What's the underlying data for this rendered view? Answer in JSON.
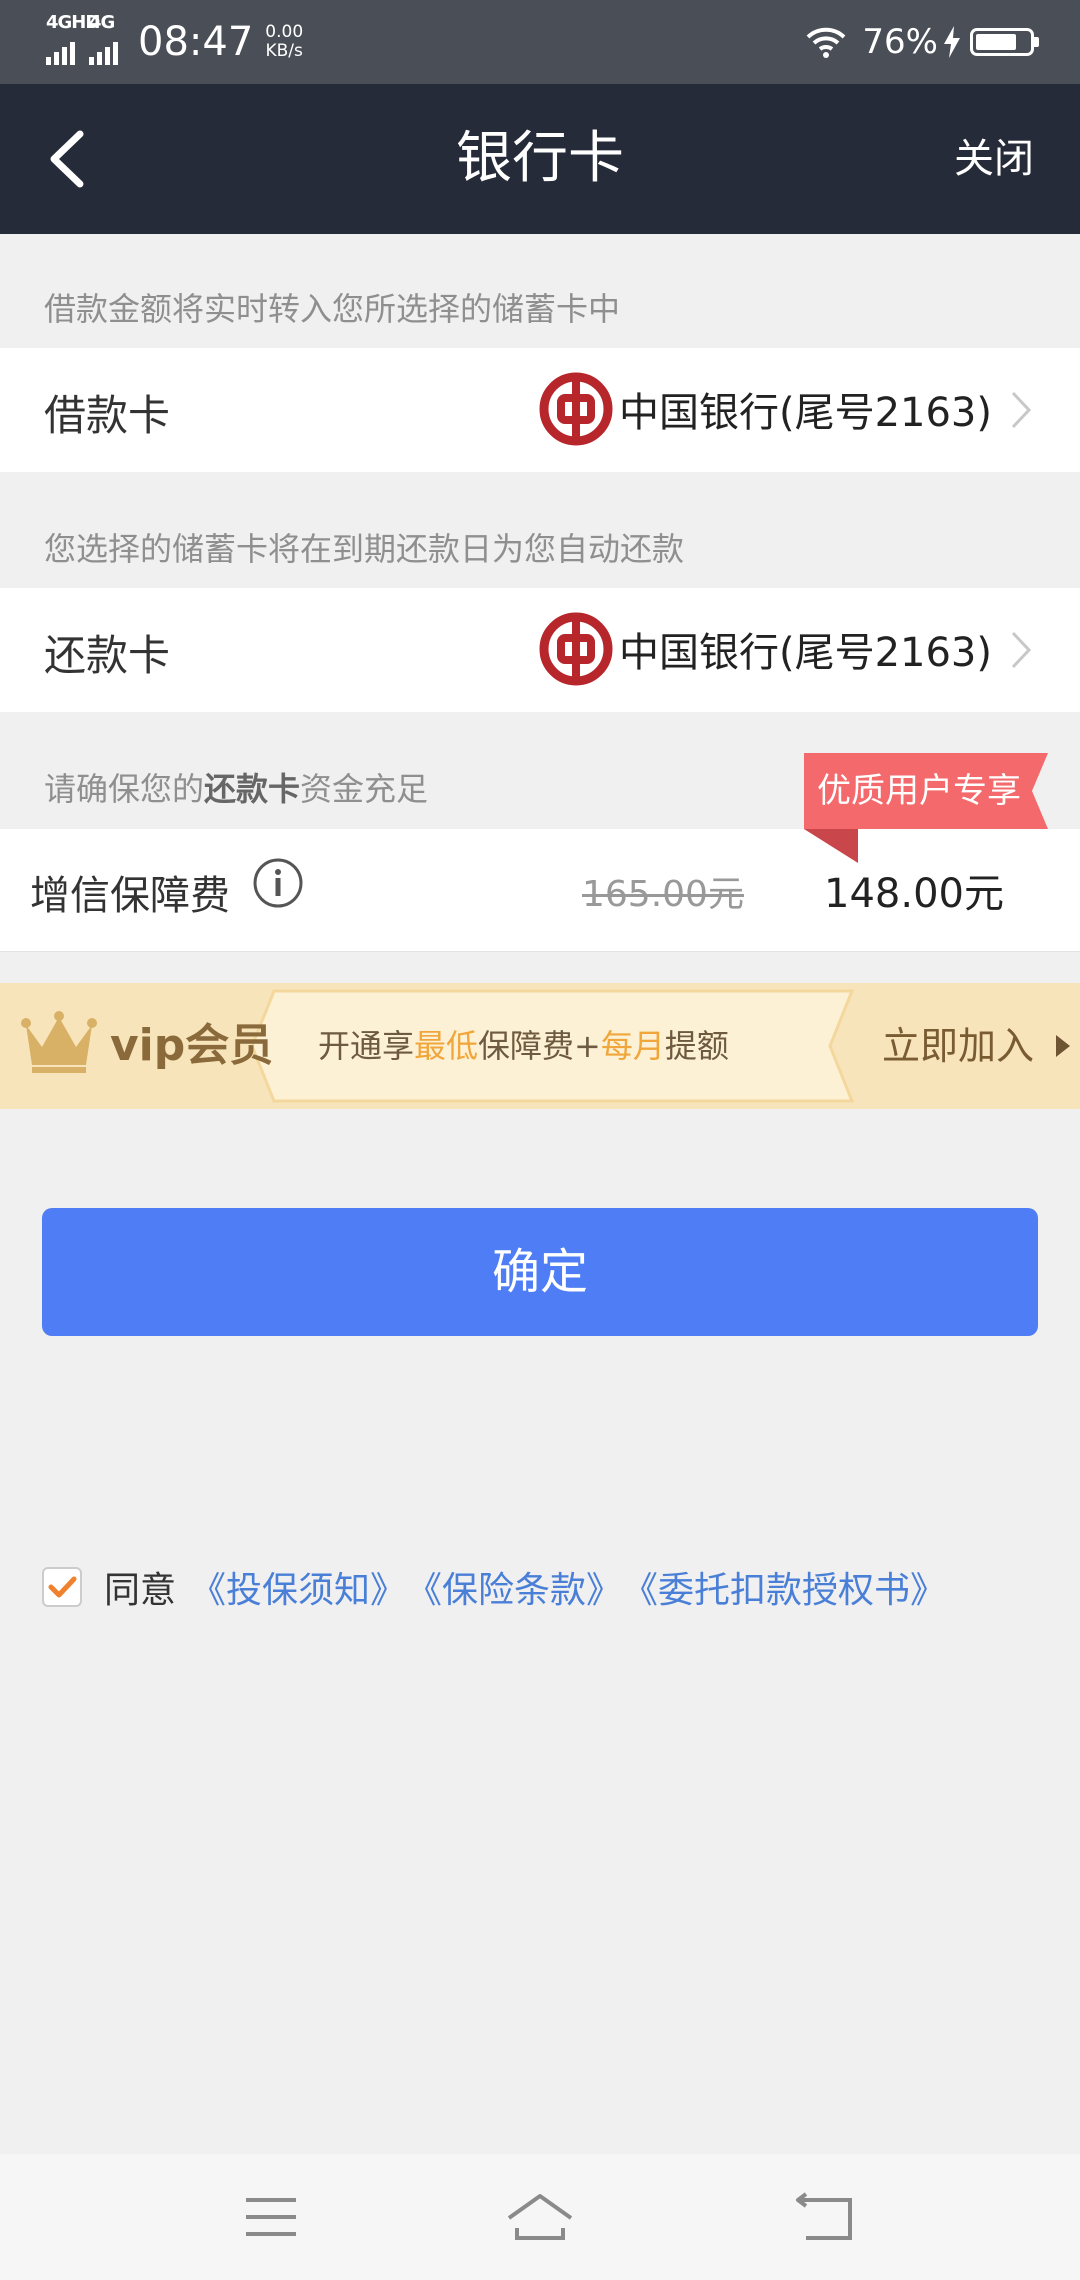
{
  "status_bar": {
    "network1": "4GHD",
    "network2": "4G",
    "time": "08:47",
    "speed_value": "0.00",
    "speed_unit": "KB/s",
    "battery_text": "76%",
    "battery_level": 0.76
  },
  "header": {
    "back_icon": "chevron-left-icon",
    "title": "银行卡",
    "close_label": "关闭"
  },
  "loan_section": {
    "hint": "借款金额将实时转入您所选择的储蓄卡中",
    "label": "借款卡",
    "bank": "中国银行(尾号2163)"
  },
  "repay_section": {
    "hint": "您选择的储蓄卡将在到期还款日为您自动还款",
    "label": "还款卡",
    "bank": "中国银行(尾号2163)"
  },
  "fee_section": {
    "hint_prefix": "请确保您的",
    "hint_bold": "还款卡",
    "hint_suffix": "资金充足",
    "ribbon": "优质用户专享",
    "fee_label": "增信保障费",
    "original_price": "165.00元",
    "price": "148.00元"
  },
  "vip": {
    "title": "vip会员",
    "desc_1": "开通享",
    "desc_hl_1": "最低",
    "desc_2": "保障费+",
    "desc_hl_2": "每月",
    "desc_3": "提额",
    "join_label": "立即加入",
    "colors": {
      "highlight": "#f0a63a",
      "banner": "#f8e4bb"
    }
  },
  "confirm": {
    "label": "确定",
    "color": "#4e7df5"
  },
  "agreement": {
    "checked": true,
    "prefix": "同意",
    "links": [
      "《投保须知》",
      "《保险条款》",
      "《委托扣款授权书》"
    ]
  },
  "system_nav": {
    "icons": [
      "menu-icon",
      "home-icon",
      "back-icon"
    ]
  }
}
